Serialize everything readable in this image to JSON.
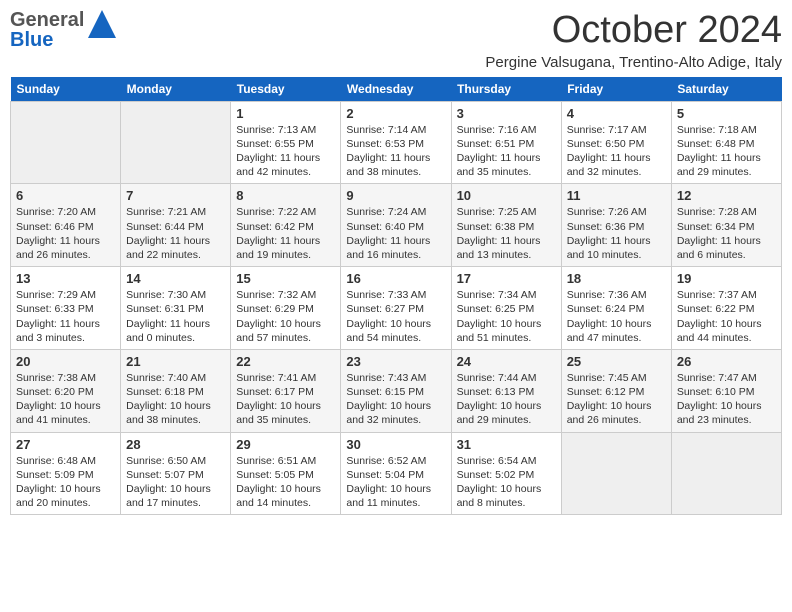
{
  "header": {
    "logo_general": "General",
    "logo_blue": "Blue",
    "month_year": "October 2024",
    "location": "Pergine Valsugana, Trentino-Alto Adige, Italy"
  },
  "days_of_week": [
    "Sunday",
    "Monday",
    "Tuesday",
    "Wednesday",
    "Thursday",
    "Friday",
    "Saturday"
  ],
  "weeks": [
    [
      {
        "day": "",
        "info": ""
      },
      {
        "day": "",
        "info": ""
      },
      {
        "day": "1",
        "info": "Sunrise: 7:13 AM\nSunset: 6:55 PM\nDaylight: 11 hours and 42 minutes."
      },
      {
        "day": "2",
        "info": "Sunrise: 7:14 AM\nSunset: 6:53 PM\nDaylight: 11 hours and 38 minutes."
      },
      {
        "day": "3",
        "info": "Sunrise: 7:16 AM\nSunset: 6:51 PM\nDaylight: 11 hours and 35 minutes."
      },
      {
        "day": "4",
        "info": "Sunrise: 7:17 AM\nSunset: 6:50 PM\nDaylight: 11 hours and 32 minutes."
      },
      {
        "day": "5",
        "info": "Sunrise: 7:18 AM\nSunset: 6:48 PM\nDaylight: 11 hours and 29 minutes."
      }
    ],
    [
      {
        "day": "6",
        "info": "Sunrise: 7:20 AM\nSunset: 6:46 PM\nDaylight: 11 hours and 26 minutes."
      },
      {
        "day": "7",
        "info": "Sunrise: 7:21 AM\nSunset: 6:44 PM\nDaylight: 11 hours and 22 minutes."
      },
      {
        "day": "8",
        "info": "Sunrise: 7:22 AM\nSunset: 6:42 PM\nDaylight: 11 hours and 19 minutes."
      },
      {
        "day": "9",
        "info": "Sunrise: 7:24 AM\nSunset: 6:40 PM\nDaylight: 11 hours and 16 minutes."
      },
      {
        "day": "10",
        "info": "Sunrise: 7:25 AM\nSunset: 6:38 PM\nDaylight: 11 hours and 13 minutes."
      },
      {
        "day": "11",
        "info": "Sunrise: 7:26 AM\nSunset: 6:36 PM\nDaylight: 11 hours and 10 minutes."
      },
      {
        "day": "12",
        "info": "Sunrise: 7:28 AM\nSunset: 6:34 PM\nDaylight: 11 hours and 6 minutes."
      }
    ],
    [
      {
        "day": "13",
        "info": "Sunrise: 7:29 AM\nSunset: 6:33 PM\nDaylight: 11 hours and 3 minutes."
      },
      {
        "day": "14",
        "info": "Sunrise: 7:30 AM\nSunset: 6:31 PM\nDaylight: 11 hours and 0 minutes."
      },
      {
        "day": "15",
        "info": "Sunrise: 7:32 AM\nSunset: 6:29 PM\nDaylight: 10 hours and 57 minutes."
      },
      {
        "day": "16",
        "info": "Sunrise: 7:33 AM\nSunset: 6:27 PM\nDaylight: 10 hours and 54 minutes."
      },
      {
        "day": "17",
        "info": "Sunrise: 7:34 AM\nSunset: 6:25 PM\nDaylight: 10 hours and 51 minutes."
      },
      {
        "day": "18",
        "info": "Sunrise: 7:36 AM\nSunset: 6:24 PM\nDaylight: 10 hours and 47 minutes."
      },
      {
        "day": "19",
        "info": "Sunrise: 7:37 AM\nSunset: 6:22 PM\nDaylight: 10 hours and 44 minutes."
      }
    ],
    [
      {
        "day": "20",
        "info": "Sunrise: 7:38 AM\nSunset: 6:20 PM\nDaylight: 10 hours and 41 minutes."
      },
      {
        "day": "21",
        "info": "Sunrise: 7:40 AM\nSunset: 6:18 PM\nDaylight: 10 hours and 38 minutes."
      },
      {
        "day": "22",
        "info": "Sunrise: 7:41 AM\nSunset: 6:17 PM\nDaylight: 10 hours and 35 minutes."
      },
      {
        "day": "23",
        "info": "Sunrise: 7:43 AM\nSunset: 6:15 PM\nDaylight: 10 hours and 32 minutes."
      },
      {
        "day": "24",
        "info": "Sunrise: 7:44 AM\nSunset: 6:13 PM\nDaylight: 10 hours and 29 minutes."
      },
      {
        "day": "25",
        "info": "Sunrise: 7:45 AM\nSunset: 6:12 PM\nDaylight: 10 hours and 26 minutes."
      },
      {
        "day": "26",
        "info": "Sunrise: 7:47 AM\nSunset: 6:10 PM\nDaylight: 10 hours and 23 minutes."
      }
    ],
    [
      {
        "day": "27",
        "info": "Sunrise: 6:48 AM\nSunset: 5:09 PM\nDaylight: 10 hours and 20 minutes."
      },
      {
        "day": "28",
        "info": "Sunrise: 6:50 AM\nSunset: 5:07 PM\nDaylight: 10 hours and 17 minutes."
      },
      {
        "day": "29",
        "info": "Sunrise: 6:51 AM\nSunset: 5:05 PM\nDaylight: 10 hours and 14 minutes."
      },
      {
        "day": "30",
        "info": "Sunrise: 6:52 AM\nSunset: 5:04 PM\nDaylight: 10 hours and 11 minutes."
      },
      {
        "day": "31",
        "info": "Sunrise: 6:54 AM\nSunset: 5:02 PM\nDaylight: 10 hours and 8 minutes."
      },
      {
        "day": "",
        "info": ""
      },
      {
        "day": "",
        "info": ""
      }
    ]
  ]
}
